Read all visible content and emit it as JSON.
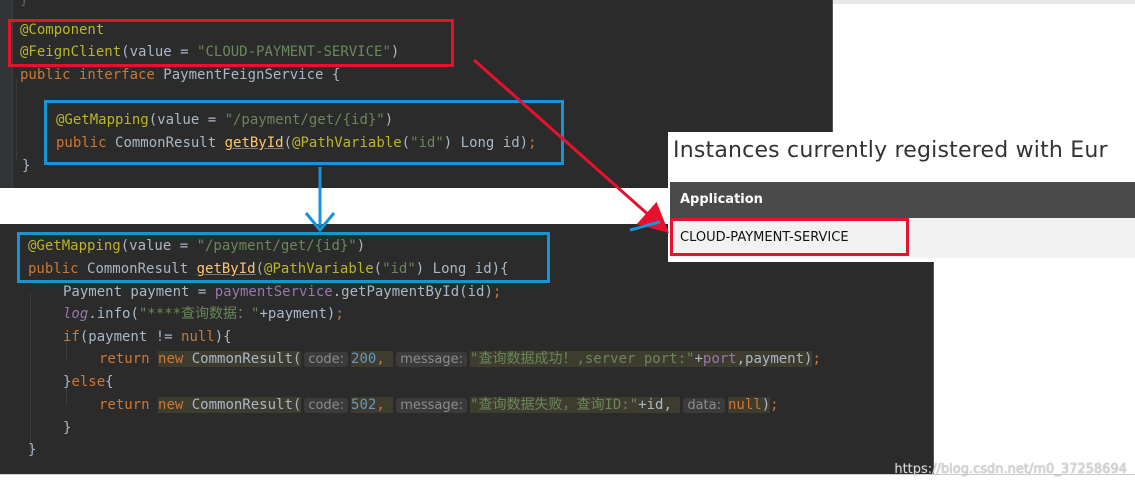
{
  "panel1": {
    "lines": [
      {
        "segs": [
          {
            "t": "@Component",
            "c": "ann"
          }
        ]
      },
      {
        "segs": [
          {
            "t": "@FeignClient",
            "c": "ann"
          },
          {
            "t": "(",
            "c": "plain"
          },
          {
            "t": "value = ",
            "c": "plain"
          },
          {
            "t": "\"CLOUD-PAYMENT-SERVICE\"",
            "c": "str"
          },
          {
            "t": ")",
            "c": "plain"
          }
        ]
      },
      {
        "segs": [
          {
            "t": "public interface ",
            "c": "kw"
          },
          {
            "t": "PaymentFeignService {",
            "c": "plain"
          }
        ]
      },
      {
        "segs": [
          {
            "t": "@GetMapping",
            "c": "ann"
          },
          {
            "t": "(value = ",
            "c": "plain"
          },
          {
            "t": "\"/payment/get/{id}\"",
            "c": "str"
          },
          {
            "t": ")",
            "c": "plain"
          }
        ]
      },
      {
        "segs": [
          {
            "t": "public ",
            "c": "kw"
          },
          {
            "t": "CommonResult ",
            "c": "plain"
          },
          {
            "t": "getById",
            "c": "meth"
          },
          {
            "t": "(",
            "c": "plain"
          },
          {
            "t": "@PathVariable",
            "c": "ann"
          },
          {
            "t": "(",
            "c": "plain"
          },
          {
            "t": "\"id\"",
            "c": "str"
          },
          {
            "t": ") Long id)",
            "c": "plain"
          },
          {
            "t": ";",
            "c": "kw"
          }
        ]
      },
      {
        "segs": [
          {
            "t": "}",
            "c": "plain"
          }
        ]
      }
    ]
  },
  "panel2": {
    "lines": [
      {
        "segs": [
          {
            "t": "@GetMapping",
            "c": "ann"
          },
          {
            "t": "(value = ",
            "c": "plain"
          },
          {
            "t": "\"/payment/get/{id}\"",
            "c": "str"
          },
          {
            "t": ")",
            "c": "plain"
          }
        ]
      },
      {
        "segs": [
          {
            "t": "public ",
            "c": "kw"
          },
          {
            "t": "CommonResult ",
            "c": "plain"
          },
          {
            "t": "getById",
            "c": "meth"
          },
          {
            "t": "(",
            "c": "plain"
          },
          {
            "t": "@PathVariable",
            "c": "ann"
          },
          {
            "t": "(",
            "c": "plain"
          },
          {
            "t": "\"id\"",
            "c": "str"
          },
          {
            "t": ") Long id){",
            "c": "plain"
          }
        ]
      },
      {
        "segs": [
          {
            "t": "Payment payment = ",
            "c": "plain"
          },
          {
            "t": "paymentService",
            "c": "fld"
          },
          {
            "t": ".getPaymentById(id)",
            "c": "plain"
          },
          {
            "t": ";",
            "c": "kw"
          }
        ]
      },
      {
        "segs": [
          {
            "t": "log",
            "c": "ital"
          },
          {
            "t": ".info(",
            "c": "plain"
          },
          {
            "t": "\"****查询数据：\"",
            "c": "str"
          },
          {
            "t": "+payment)",
            "c": "plain"
          },
          {
            "t": ";",
            "c": "kw"
          }
        ]
      },
      {
        "segs": [
          {
            "t": "if",
            "c": "kw"
          },
          {
            "t": "(payment != ",
            "c": "plain"
          },
          {
            "t": "null",
            "c": "kw"
          },
          {
            "t": "){",
            "c": "plain"
          }
        ]
      },
      {
        "segs": [
          {
            "t": "return ",
            "c": "kw"
          },
          {
            "t": "new ",
            "c": "kw",
            "h": 1
          },
          {
            "t": "CommonResult(",
            "c": "plain",
            "h": 1
          },
          {
            "t": "code:",
            "c": "hint"
          },
          {
            "t": "200",
            "c": "num",
            "h": 1
          },
          {
            "t": ", ",
            "c": "kw",
            "h": 1
          },
          {
            "t": "message:",
            "c": "hint"
          },
          {
            "t": "\"查询数据成功！,server port:\"",
            "c": "str",
            "h": 1
          },
          {
            "t": "+",
            "c": "plain",
            "h": 1
          },
          {
            "t": "port",
            "c": "fld",
            "h": 1
          },
          {
            "t": ",payment)",
            "c": "plain",
            "h": 1
          },
          {
            "t": ";",
            "c": "kw"
          }
        ]
      },
      {
        "segs": [
          {
            "t": "}",
            "c": "plain"
          },
          {
            "t": "else",
            "c": "kw"
          },
          {
            "t": "{",
            "c": "plain"
          }
        ]
      },
      {
        "segs": [
          {
            "t": "return ",
            "c": "kw"
          },
          {
            "t": "new ",
            "c": "kw",
            "h": 1
          },
          {
            "t": "CommonResult(",
            "c": "plain",
            "h": 1
          },
          {
            "t": "code:",
            "c": "hint"
          },
          {
            "t": "502",
            "c": "num",
            "h": 1
          },
          {
            "t": ", ",
            "c": "kw",
            "h": 1
          },
          {
            "t": "message:",
            "c": "hint"
          },
          {
            "t": "\"查询数据失败，查询ID:\"",
            "c": "str",
            "h": 1
          },
          {
            "t": "+id, ",
            "c": "plain",
            "h": 1
          },
          {
            "t": "data:",
            "c": "hint"
          },
          {
            "t": "null",
            "c": "kw",
            "h": 1
          },
          {
            "t": ")",
            "c": "plain",
            "h": 1
          },
          {
            "t": ";",
            "c": "kw"
          }
        ]
      },
      {
        "segs": [
          {
            "t": "}",
            "c": "plain"
          }
        ]
      },
      {
        "segs": [
          {
            "t": "}",
            "c": "plain"
          }
        ]
      }
    ]
  },
  "eureka": {
    "title": "Instances currently registered with Eur",
    "header_label": "Application",
    "app_name": "CLOUD-PAYMENT-SERVICE"
  },
  "watermark": "https://blog.csdn.net/m0_37258694",
  "colors": {
    "red_box": "#e8112d",
    "blue_box": "#1793d8",
    "editor_bg": "#2b2b2b",
    "eureka_header": "#4a4a4a"
  }
}
